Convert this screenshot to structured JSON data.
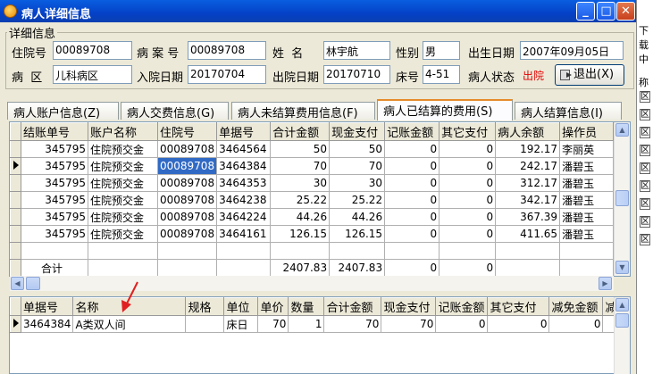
{
  "window": {
    "title": "病人详细信息"
  },
  "bg_window": {
    "texts": [
      "下载",
      "中",
      "称"
    ],
    "checkbox_label": "区"
  },
  "detail": {
    "group_title": "详细信息",
    "inpatient_no_label": "住院号",
    "inpatient_no": "00089708",
    "case_no_label": "病 案 号",
    "case_no": "00089708",
    "name_label": "姓  名",
    "name": "林宇航",
    "sex_label": "性别",
    "sex": "男",
    "birth_label": "出生日期",
    "birth": "2007年09月05日",
    "ward_label": "病  区",
    "ward": "儿科病区",
    "admit_label": "入院日期",
    "admit": "20170704",
    "discharge_label": "出院日期",
    "discharge": "20170710",
    "bed_label": "床号",
    "bed": "4-51",
    "status_label": "病人状态",
    "status": "出院",
    "exit_button": "退出(X)",
    "status_color": "#e00000"
  },
  "tabs": [
    {
      "label": "病人账户信息(Z)"
    },
    {
      "label": "病人交费信息(G)"
    },
    {
      "label": "病人未结算费用信息(F)"
    },
    {
      "label": "病人已结算的费用(S)",
      "active": true
    },
    {
      "label": "病人结算信息(I)"
    }
  ],
  "top_grid": {
    "columns": [
      "结账单号",
      "账户名称",
      "住院号",
      "单据号",
      "合计金额",
      "现金支付",
      "记账金额",
      "其它支付",
      "病人余额",
      "操作员"
    ],
    "rows": [
      [
        "345795",
        "住院预交金",
        "00089708",
        "3464564",
        "50",
        "50",
        "0",
        "0",
        "192.17",
        "李丽英"
      ],
      [
        "345795",
        "住院预交金",
        "00089708",
        "3464384",
        "70",
        "70",
        "0",
        "0",
        "242.17",
        "潘碧玉"
      ],
      [
        "345795",
        "住院预交金",
        "00089708",
        "3464353",
        "30",
        "30",
        "0",
        "0",
        "312.17",
        "潘碧玉"
      ],
      [
        "345795",
        "住院预交金",
        "00089708",
        "3464238",
        "25.22",
        "25.22",
        "0",
        "0",
        "342.17",
        "潘碧玉"
      ],
      [
        "345795",
        "住院预交金",
        "00089708",
        "3464224",
        "44.26",
        "44.26",
        "0",
        "0",
        "367.39",
        "潘碧玉"
      ],
      [
        "345795",
        "住院预交金",
        "00089708",
        "3464161",
        "126.15",
        "126.15",
        "0",
        "0",
        "411.65",
        "潘碧玉"
      ]
    ],
    "total": {
      "label": "合计",
      "sum_amount": "2407.83",
      "cash": "2407.83",
      "account": "0",
      "other": "0"
    }
  },
  "bottom_grid": {
    "columns": [
      "单据号",
      "名称",
      "规格",
      "单位",
      "单价",
      "数量",
      "合计金额",
      "现金支付",
      "记账金额",
      "其它支付",
      "减免金额",
      "减"
    ],
    "rows": [
      [
        "3464384",
        "A类双人间",
        "",
        "床日",
        "70",
        "1",
        "70",
        "70",
        "0",
        "0",
        "0",
        ""
      ]
    ]
  },
  "colors": {
    "title_bar": "#0441c7",
    "selection": "#316ac5",
    "annotation_arrow": "#e02020"
  }
}
